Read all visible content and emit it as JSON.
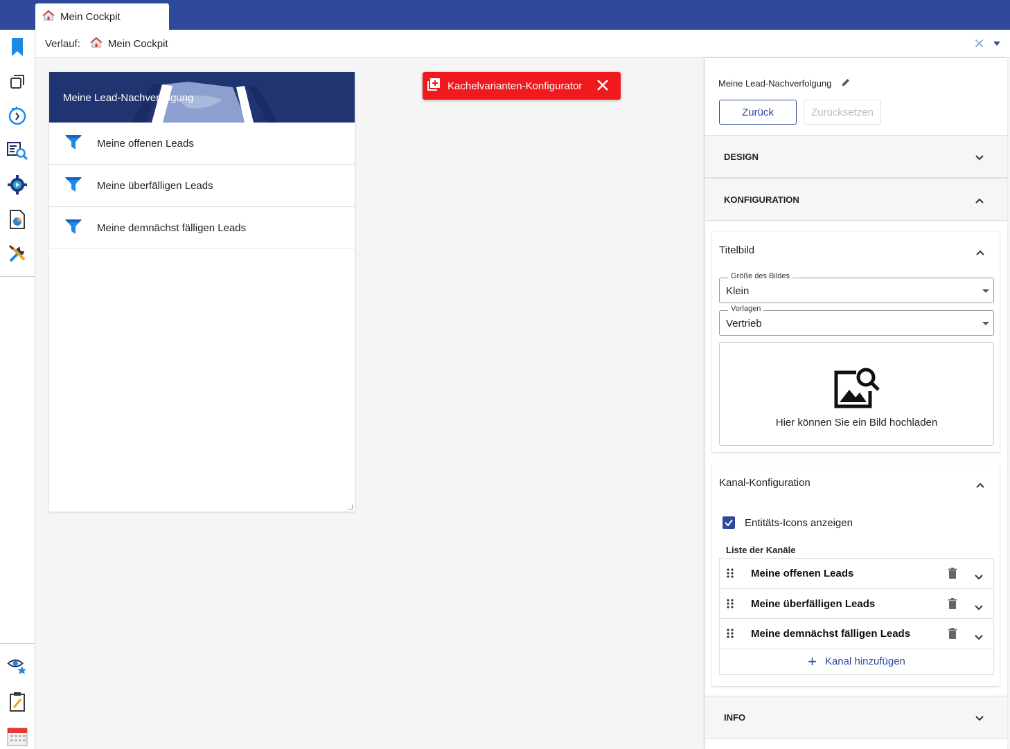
{
  "window": {
    "tab_label": "Mein Cockpit"
  },
  "breadcrumb": {
    "label": "Verlauf:",
    "item": "Mein Cockpit"
  },
  "sidebar": {
    "icons": [
      "bookmark-icon",
      "windows-icon",
      "history-icon",
      "search-list-icon",
      "settings-gear-icon",
      "report-icon",
      "tools-icon",
      "watch-star-icon",
      "notes-icon",
      "calendar-icon"
    ]
  },
  "tile": {
    "title": "Meine Lead-Nachverfolgung",
    "rows": [
      {
        "label": "Meine offenen Leads"
      },
      {
        "label": "Meine überfälligen Leads"
      },
      {
        "label": "Meine demnächst fälligen Leads"
      }
    ]
  },
  "toast": {
    "label": "Kachelvarianten-Konfigurator",
    "color": "#f0191e"
  },
  "panel": {
    "title": "Meine Lead-Nachverfolgung",
    "back_label": "Zurück",
    "reset_label": "Zurücksetzen",
    "sections": {
      "design": "DESIGN",
      "konfiguration": "KONFIGURATION",
      "info": "INFO"
    },
    "titelbild": {
      "title": "Titelbild",
      "size_label": "Größe des Bildes",
      "size_value": "Klein",
      "templates_label": "Vorlagen",
      "templates_value": "Vertrieb",
      "upload_text": "Hier können Sie ein Bild hochladen"
    },
    "kanal": {
      "title": "Kanal-Konfiguration",
      "checkbox_label": "Entitäts-Icons anzeigen",
      "checkbox_checked": true,
      "list_label": "Liste der Kanäle",
      "channels": [
        {
          "name": "Meine offenen Leads"
        },
        {
          "name": "Meine überfälligen Leads"
        },
        {
          "name": "Meine demnächst fälligen Leads"
        }
      ],
      "add_label": "Kanal hinzufügen"
    }
  },
  "colors": {
    "topbar": "#2f4a9c",
    "accent": "#2f4a9c",
    "toast": "#f0191e"
  }
}
